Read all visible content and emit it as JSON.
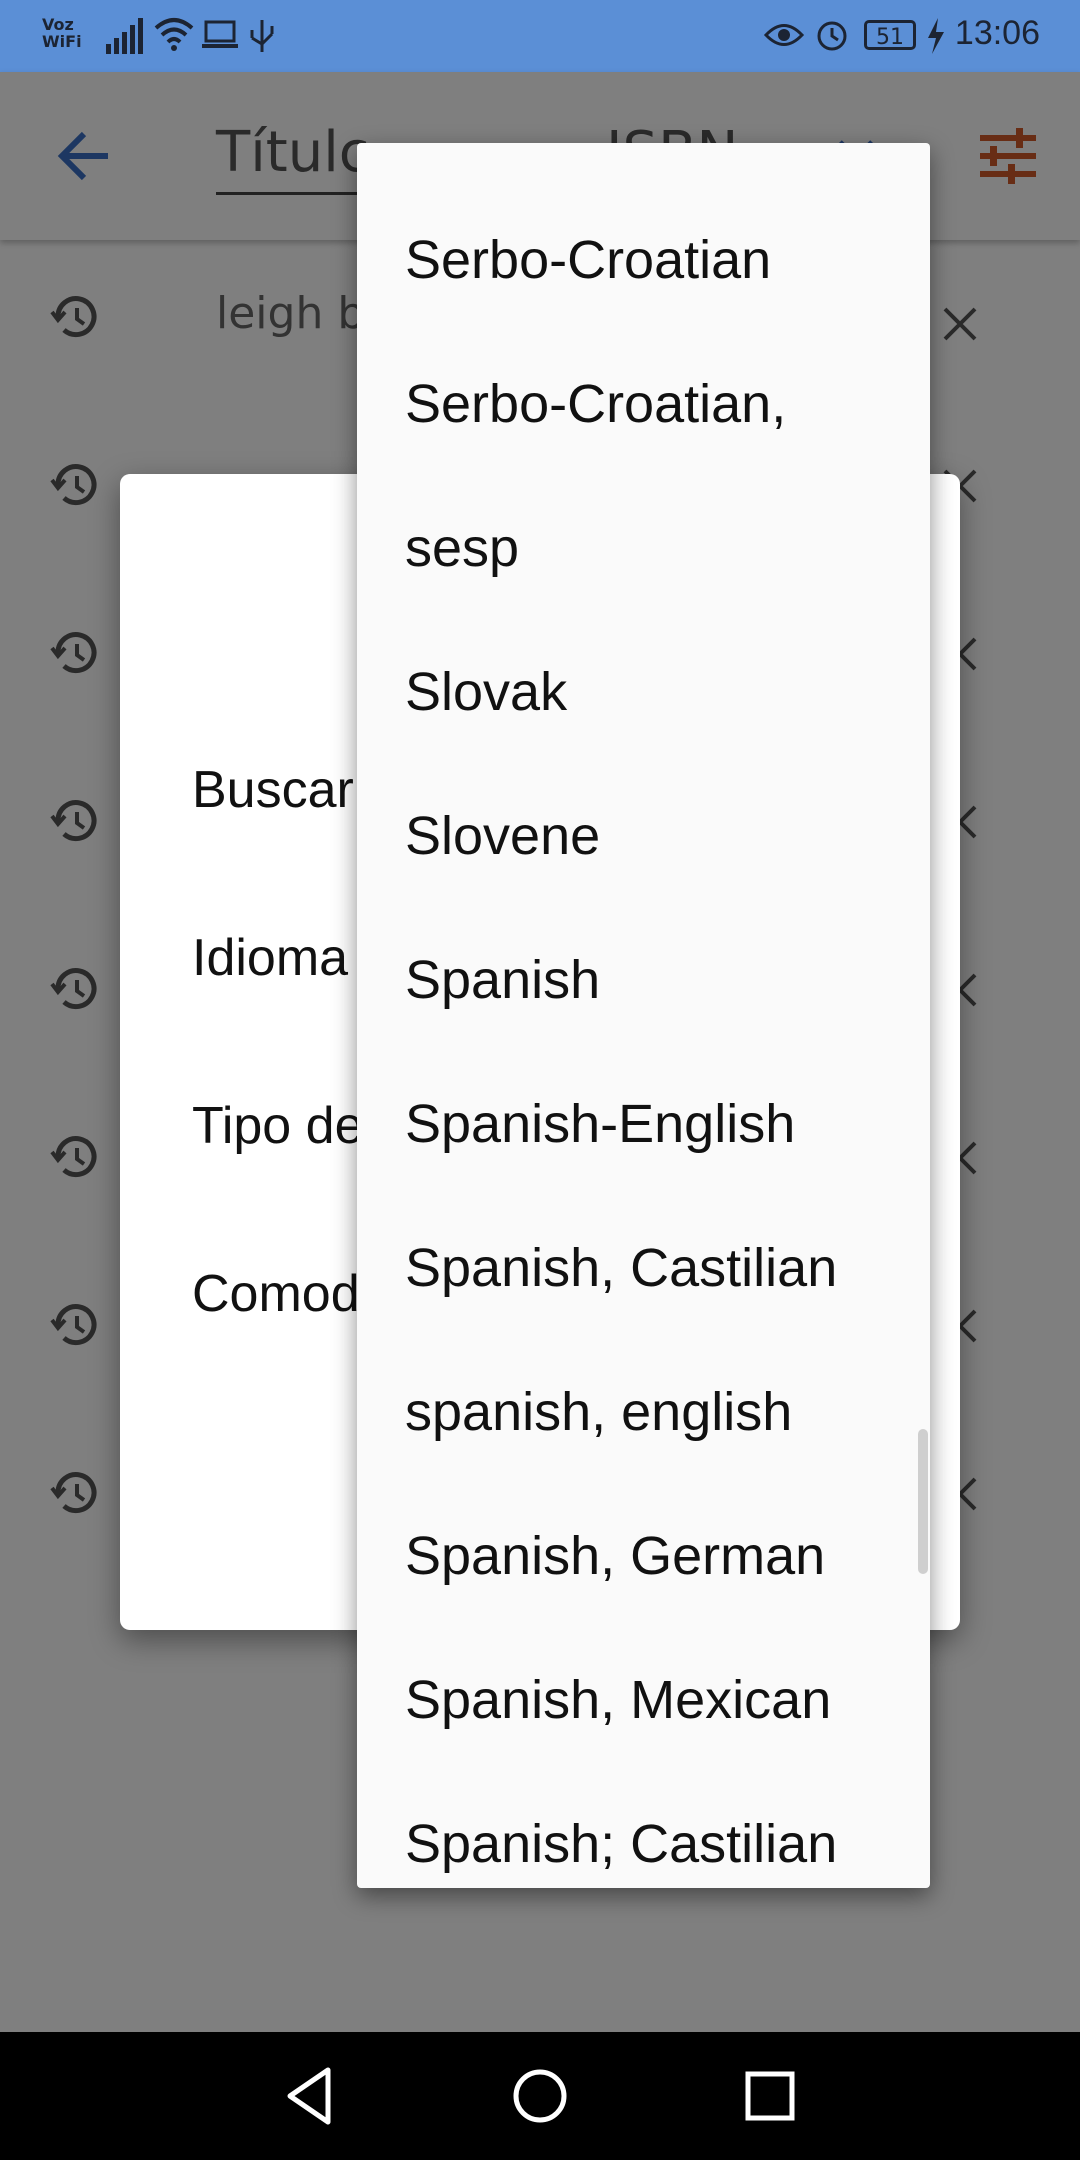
{
  "status_bar": {
    "carrier_line1": "Voz",
    "carrier_line2": "WiFi",
    "battery": "51",
    "time": "13:06",
    "icons": [
      "signal-icon",
      "wifi-icon",
      "laptop-icon",
      "usb-icon",
      "eye-icon",
      "alarm-icon",
      "battery-icon",
      "charging-icon"
    ]
  },
  "app_bar": {
    "search_placeholder": "Título, autor o ISBN",
    "visible_text": "Títulc",
    "visible_text_right": "ISBN",
    "icons": [
      "back-arrow-icon",
      "clear-icon",
      "filter-icon"
    ]
  },
  "history": {
    "first_item_visible": "leigh ba",
    "row_count": 8
  },
  "dialog": {
    "rows": [
      "Buscar",
      "Idioma",
      "Tipo de",
      "Comod"
    ]
  },
  "dropdown": {
    "options": [
      "Serbo-Croatian",
      "Serbo-Croatian,",
      "sesp",
      "Slovak",
      "Slovene",
      "Spanish",
      "Spanish-English",
      "Spanish, Castilian",
      "spanish, english",
      "Spanish, German",
      "Spanish, Mexican",
      "Spanish; Castilian"
    ]
  },
  "nav_bar": {
    "icons": [
      "nav-back-icon",
      "nav-home-icon",
      "nav-recents-icon"
    ]
  },
  "colors": {
    "status_bar": "#5b8fd6",
    "accent_blue": "#3b6fc4",
    "filter_orange": "#d05a2a"
  }
}
